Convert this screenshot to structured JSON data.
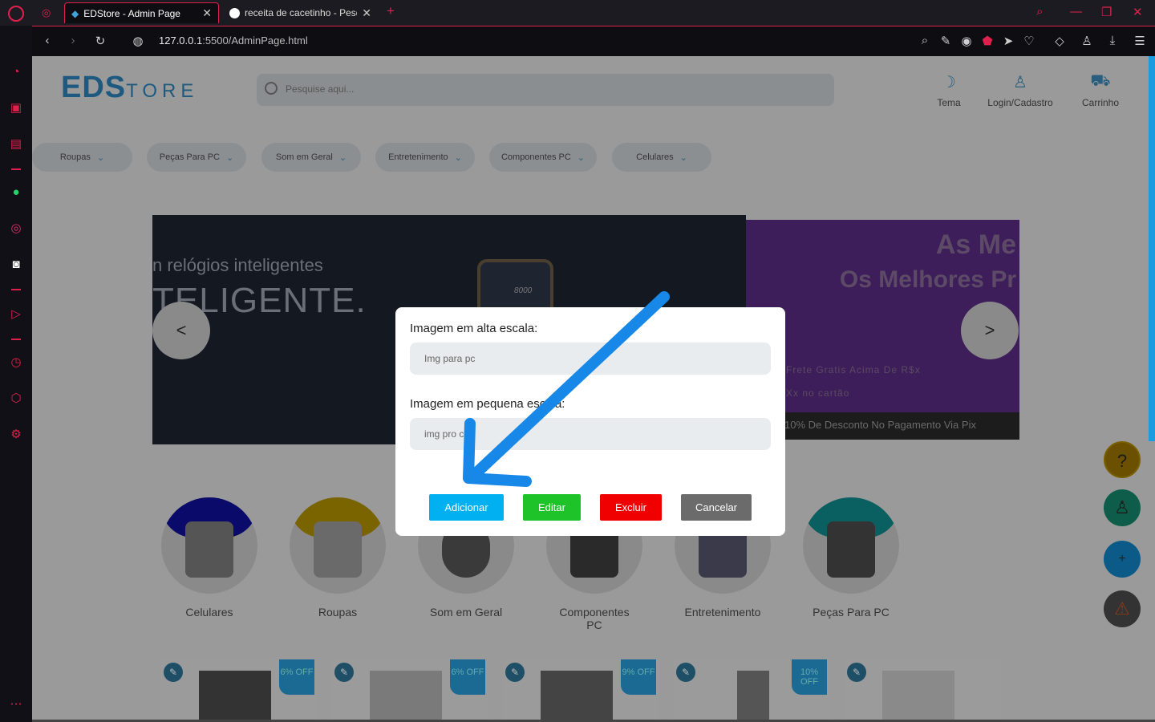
{
  "browser": {
    "tabs": [
      {
        "title": "EDStore - Admin Page",
        "close": "✕"
      },
      {
        "title": "receita de cacetinho - Pesq",
        "close": "✕"
      }
    ],
    "new_tab": "+",
    "url": "127.0.0.1:5500/AdminPage.html",
    "url_host": "127.0.0.1",
    "url_path": ":5500/AdminPage.html"
  },
  "store": {
    "logo_main": "EDS",
    "logo_sub": "TORE",
    "search_placeholder": "Pesquise aqui...",
    "header_buttons": [
      {
        "label": "Tema",
        "icon": "moon-icon"
      },
      {
        "label": "Login/Cadastro",
        "icon": "user-icon"
      },
      {
        "label": "Carrinho",
        "icon": "cart-icon"
      }
    ],
    "categories": [
      "Roupas",
      "Peças Para PC",
      "Som em Geral",
      "Entretenimento",
      "Componentes PC",
      "Celulares"
    ],
    "banner1": {
      "line1": "n relógios inteligentes",
      "line2": "TELIGENTE.",
      "watch_text": "8000"
    },
    "banner2": {
      "big1": "As Me",
      "big2": "Os Melhores Pr",
      "small1": "Frete Gratis Acima De R$x",
      "small2": "Xx no cartão",
      "footer": "10% De Desconto No Pagamento Via Pix"
    },
    "prev": "<",
    "next": ">",
    "circles": [
      "Celulares",
      "Roupas",
      "Som em Geral",
      "Componentes PC",
      "Entretenimento",
      "Peças Para PC"
    ],
    "cards": [
      {
        "off": "6% OFF"
      },
      {
        "off": "6% OFF"
      },
      {
        "off": "9% OFF"
      },
      {
        "off": "10% OFF"
      },
      {
        "off": ""
      }
    ]
  },
  "modal": {
    "label_high": "Imagem em alta escala:",
    "placeholder_high": "Img para pc",
    "label_low": "Imagem em pequena escala:",
    "placeholder_low": "img pro c",
    "buttons": {
      "add": "Adicionar",
      "edit": "Editar",
      "delete": "Excluir",
      "cancel": "Cancelar"
    }
  },
  "colors": {
    "accent": "#e0204c",
    "add": "#00b0f0",
    "edit": "#1ec32a",
    "delete": "#f00000",
    "cancel": "#6b6b6b"
  }
}
